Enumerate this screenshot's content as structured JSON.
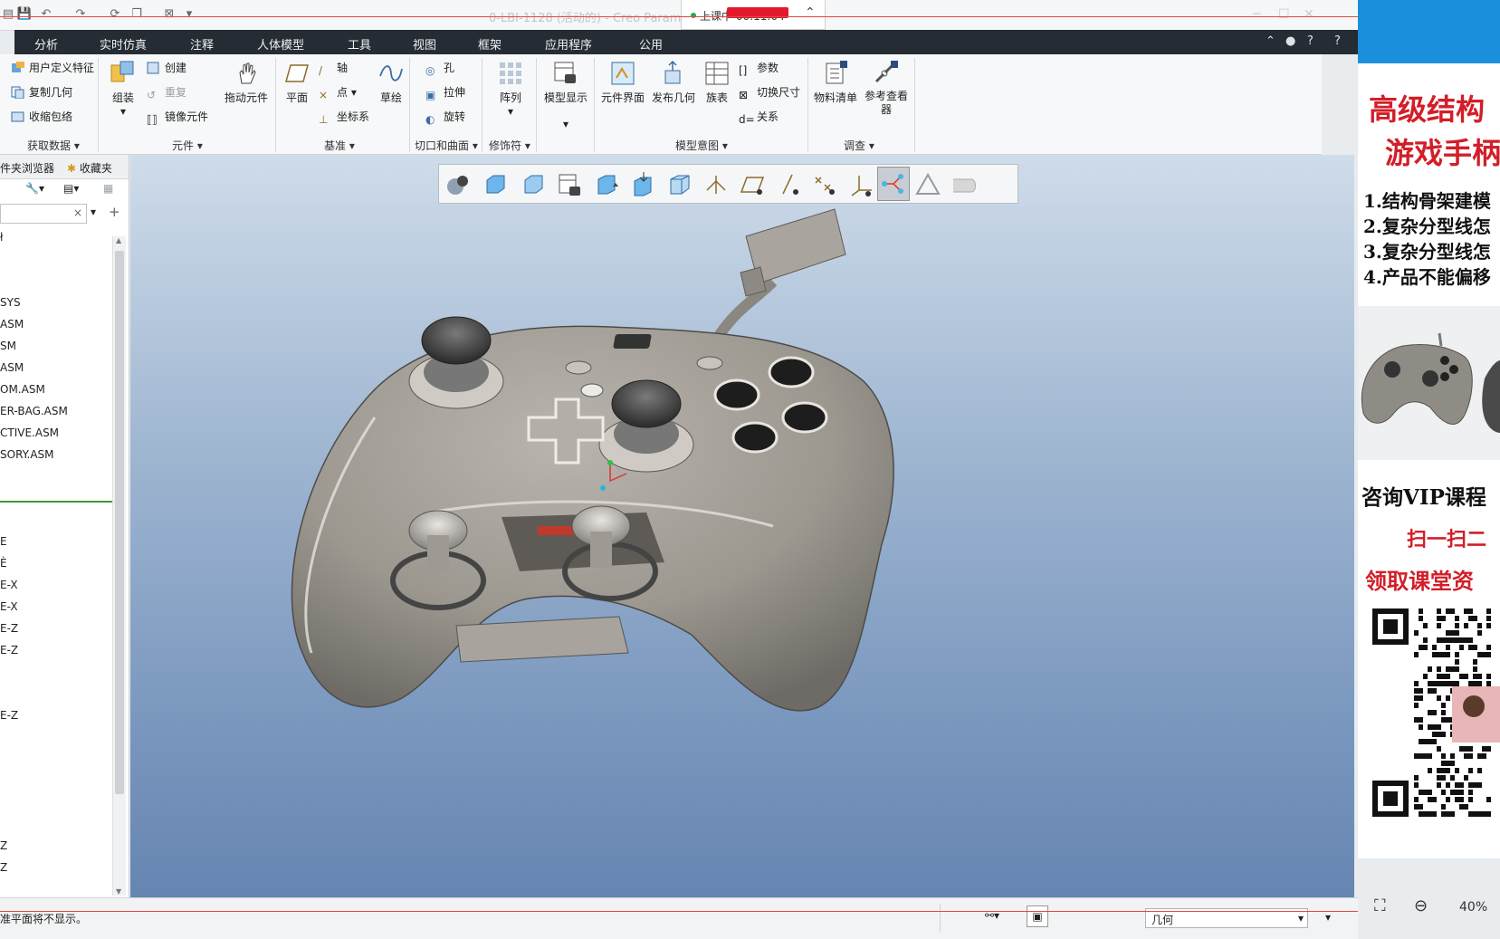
{
  "title_bar": {
    "title": "0-LBI-1128 (活动的) - Creo Parame",
    "recording_text": "上课中 00:11:04"
  },
  "menu_bar": {
    "items": [
      "分析",
      "实时仿真",
      "注释",
      "人体模型",
      "工具",
      "视图",
      "框架",
      "应用程序",
      "公用"
    ],
    "help": "?"
  },
  "ribbon": {
    "get_data": {
      "items": [
        "用户定义特征",
        "复制几何",
        "收缩包络"
      ],
      "group": "获取数据"
    },
    "components": {
      "assemble": "组装",
      "items": [
        "创建",
        "重复",
        "镜像元件"
      ],
      "drag": "拖动元件",
      "group": "元件"
    },
    "datum": {
      "plane": "平面",
      "items": [
        "轴",
        "点",
        "坐标系"
      ],
      "sketch": "草绘",
      "group": "基准"
    },
    "cut_surface": {
      "items": [
        "孔",
        "拉伸",
        "旋转"
      ],
      "group": "切口和曲面"
    },
    "modifiers": {
      "pattern": "阵列",
      "group": "修饰符"
    },
    "model_intent": {
      "model_display": "模型显示",
      "component_interface": "元件界面",
      "publish_geometry": "发布几何",
      "family_table": "族表",
      "items": [
        "参数",
        "切换尺寸",
        "关系"
      ],
      "group": "模型意图"
    },
    "investigate": {
      "bom": "物料清单",
      "ref_viewer": "参考查看器",
      "group": "调查"
    }
  },
  "left_panel": {
    "tabs": [
      "件夹浏览器",
      "收藏夹"
    ],
    "tree_items": [
      "ł",
      "",
      "",
      "SYS",
      "ASM",
      "SM",
      "ASM",
      "OM.ASM",
      "ER-BAG.ASM",
      "CTIVE.ASM",
      "SORY.ASM",
      "",
      "",
      "",
      "E",
      "È",
      "E-X",
      "E-X",
      "E-Z",
      "E-Z",
      "",
      "",
      "E-Z",
      "",
      "",
      "",
      "",
      "",
      "Z",
      "Z"
    ]
  },
  "status_bar": {
    "message": "准平面将不显示。",
    "filter_value": "几何"
  },
  "ad_panel": {
    "headline": [
      "高级结构",
      "游戏手柄"
    ],
    "points": [
      "1.结构骨架建模",
      "2.复杂分型线怎",
      "3.复杂分型线怎",
      "4.产品不能偏移"
    ],
    "cta": "咨询VIP课程",
    "scan": "扫一扫二",
    "get_materials": "领取课堂资",
    "zoom": "40%"
  },
  "colors": {
    "menu_bg": "#262c34",
    "accent_red": "#d21e28",
    "recording_badge": "#e3192b",
    "viewport_top": "#cfdcea",
    "viewport_bottom": "#6685b1"
  }
}
